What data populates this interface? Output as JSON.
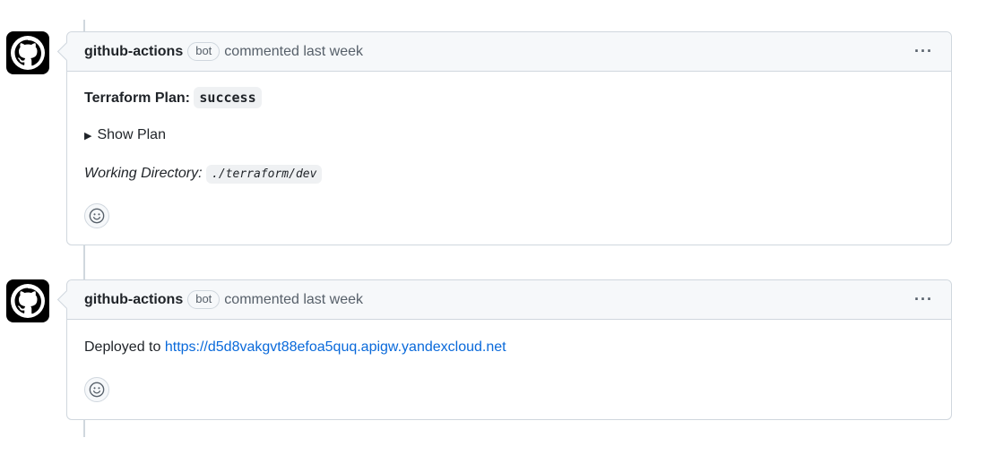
{
  "comments": [
    {
      "author": "github-actions",
      "badge": "bot",
      "meta": "commented last week",
      "more_label": "···",
      "plan_label": "Terraform Plan:",
      "plan_status": "success",
      "summary_label": "Show Plan",
      "workdir_label": "Working Directory:",
      "workdir_value": "./terraform/dev"
    },
    {
      "author": "github-actions",
      "badge": "bot",
      "meta": "commented last week",
      "more_label": "···",
      "deploy_label": "Deployed to",
      "deploy_url": "https://d5d8vakgvt88efoa5quq.apigw.yandexcloud.net"
    }
  ],
  "colors": {
    "link": "#0969da",
    "border": "#d0d7de",
    "header_bg": "#f6f8fa"
  },
  "icons": {
    "avatar": "github-mark-icon",
    "reaction": "smiley-icon",
    "summary": "triangle-right-icon"
  }
}
